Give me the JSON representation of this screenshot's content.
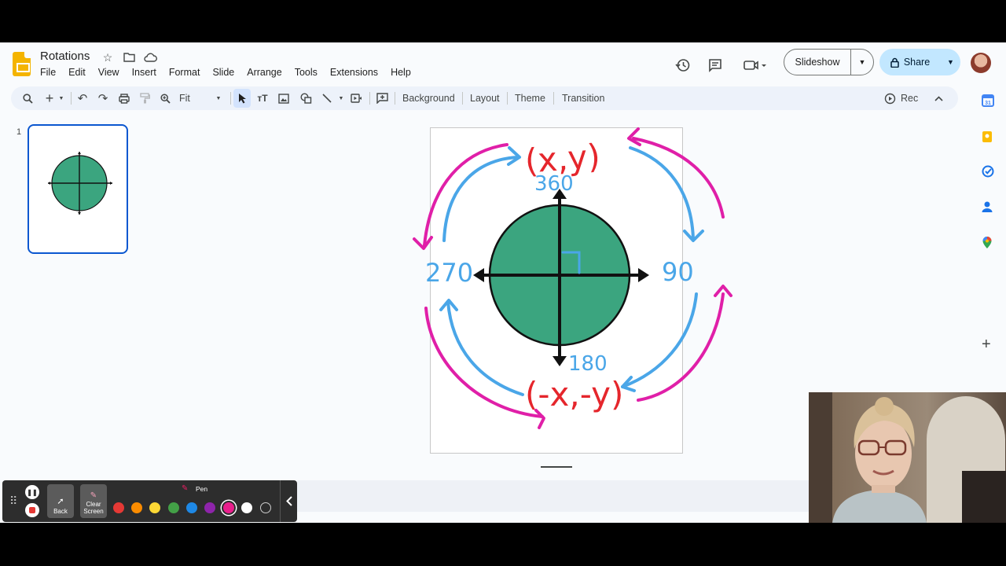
{
  "doc": {
    "title": "Rotations"
  },
  "menu": [
    "File",
    "Edit",
    "View",
    "Insert",
    "Format",
    "Slide",
    "Arrange",
    "Tools",
    "Extensions",
    "Help"
  ],
  "header": {
    "slideshow_label": "Slideshow",
    "share_label": "Share"
  },
  "toolbar": {
    "zoom_label": "Fit",
    "background_label": "Background",
    "layout_label": "Layout",
    "theme_label": "Theme",
    "transition_label": "Transition",
    "rec_label": "Rec"
  },
  "filmstrip": {
    "slide_number": "1"
  },
  "slide": {
    "label_top": "(x,y)",
    "label_bottom": "(-x,-y)",
    "angle_360": "360",
    "angle_90": "90",
    "angle_180": "180",
    "angle_270": "270",
    "circle_color": "#3ba57f",
    "red_color": "#e5262c",
    "blue_color": "#4aa6e8",
    "magenta_color": "#e01fa8"
  },
  "annotation_toolbar": {
    "back_label": "Back",
    "clear_label": "Clear Screen",
    "tool_label": "Pen",
    "colors": [
      "#e53935",
      "#fb8c00",
      "#fdd835",
      "#43a047",
      "#1e88e5",
      "#8e24aa",
      "#e91e8c",
      "#ffffff",
      "#2d2d2d"
    ],
    "selected_color": "#e91e8c"
  },
  "colors": {
    "accent": "#0b57d0",
    "share_bg": "#c2e7ff",
    "toolbar_bg": "#edf2fa",
    "logo": "#f4b400"
  }
}
